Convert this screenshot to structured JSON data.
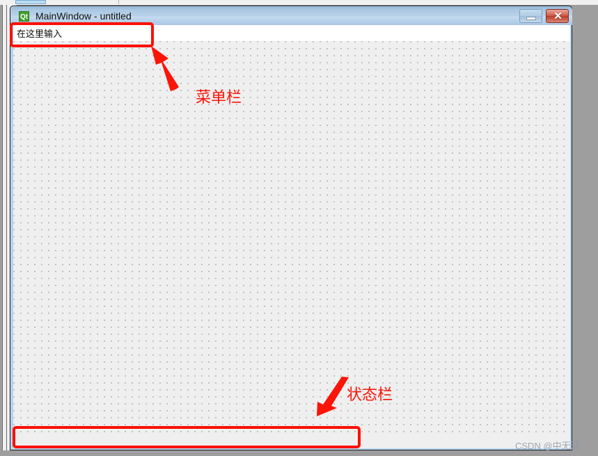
{
  "window": {
    "title": "MainWindow - untitled",
    "logo_text": "Qt",
    "logo_name": "qt-logo-icon",
    "controls": {
      "minimize_label": "",
      "minimize_name": "minimize-icon",
      "close_label": "✕",
      "close_name": "close-icon"
    }
  },
  "menu_bar": {
    "placeholder": "在这里输入"
  },
  "status_bar": {
    "text": ""
  },
  "annotations": [
    {
      "id": "menu-bar",
      "label": "菜单栏",
      "target": "menu-bar-placeholder",
      "arrow_direction": "up-left"
    },
    {
      "id": "status-bar",
      "label": "状态栏",
      "target": "status-bar",
      "arrow_direction": "down-left"
    }
  ],
  "watermark": {
    "text": "CSDN @中无涯"
  },
  "colors": {
    "annotation_red": "#fc1005",
    "title_bar_blue": "#b5d3ed",
    "canvas_gray": "#efefef",
    "grid_dot": "#b9b9b9",
    "desktop_gray": "#9e9e9e",
    "qt_logo_green": "#40a02b"
  }
}
